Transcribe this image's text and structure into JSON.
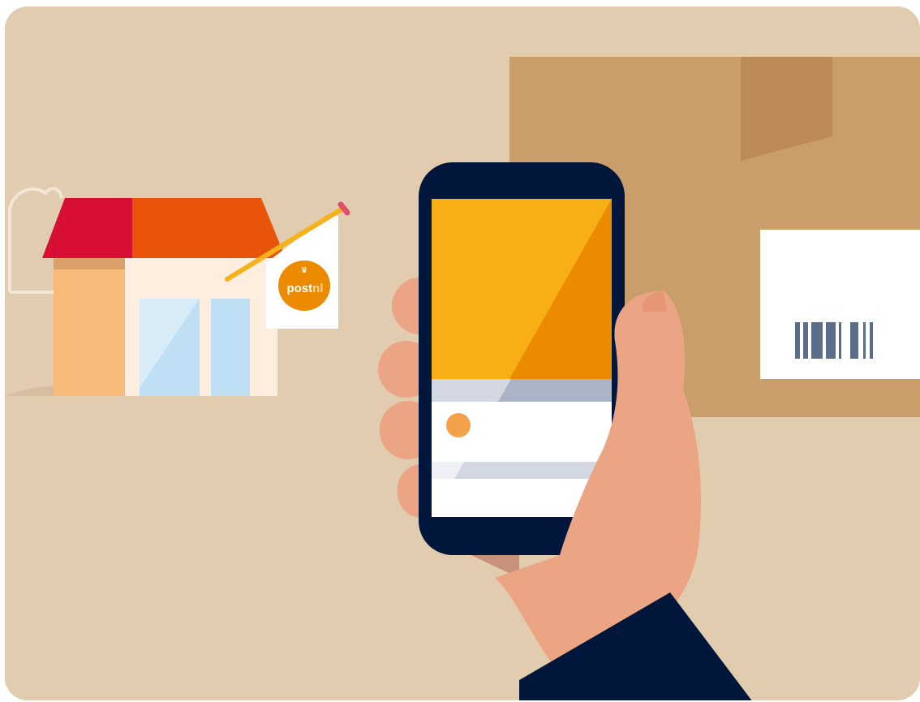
{
  "scene": {
    "description_role": "illustration",
    "colors": {
      "background": "#e2ccb0",
      "box": "#c99e6b",
      "box_flap": "#bc8a58",
      "label": "#ffffff",
      "barcode": "#5a6e8c",
      "roof_red": "#d70f35",
      "roof_orange": "#e8540a",
      "shop_wall": "#fdeee0",
      "shop_side": "#f8bb79",
      "window": "#bfe0f4",
      "flag": "#ffffff",
      "pole": "#f7b21b",
      "postnl_orange": "#ec8a00",
      "phone_body": "#00163a",
      "screen_yellow": "#f8ae15",
      "screen_orange": "#ec8a00",
      "screen_grey": "#d2d7e1",
      "screen_white": "#ffffff",
      "screen_dot": "#f4a24a",
      "skin": "#eba584",
      "skin_dark": "#e59674",
      "sleeve": "#00163a"
    }
  },
  "logo": {
    "text_post": "post",
    "text_nl": "nl",
    "icon": "crown-icon"
  }
}
